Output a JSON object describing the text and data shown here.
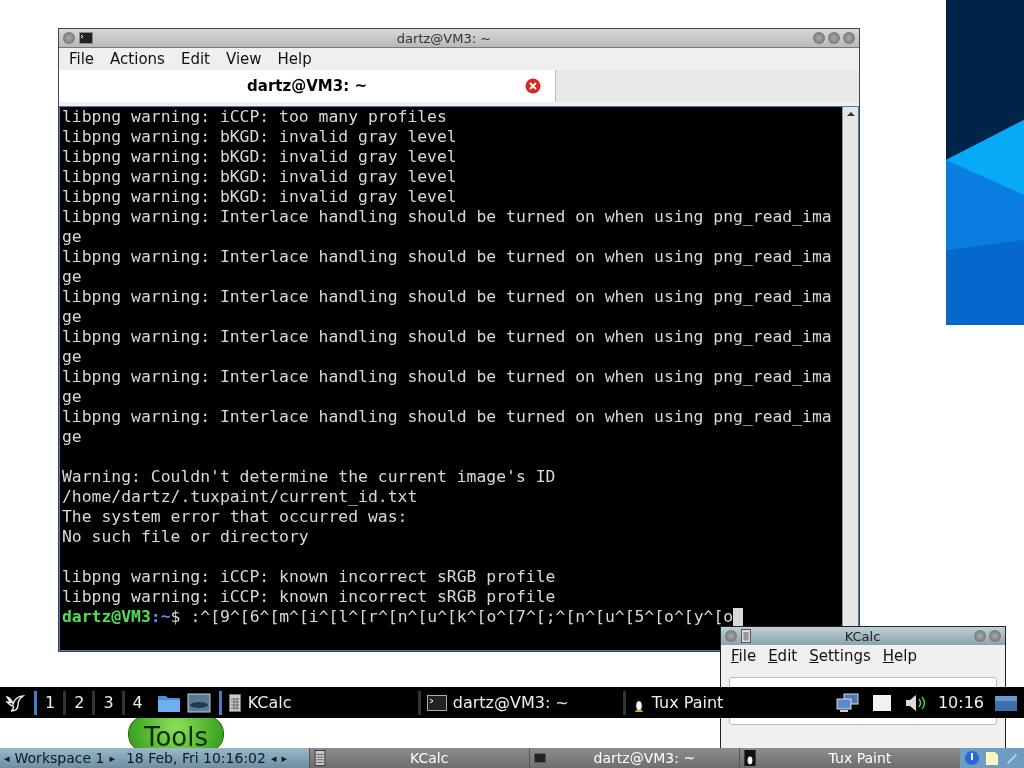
{
  "terminal": {
    "title": "dartz@VM3: ~",
    "menu": [
      "File",
      "Actions",
      "Edit",
      "View",
      "Help"
    ],
    "tab": {
      "label": "dartz@VM3: ~",
      "selected": true
    },
    "blocks": [
      [
        "libpng warning: iCCP: too many profiles",
        "libpng warning: bKGD: invalid gray level",
        "libpng warning: bKGD: invalid gray level",
        "libpng warning: bKGD: invalid gray level",
        "libpng warning: bKGD: invalid gray level",
        "libpng warning: Interlace handling should be turned on when using png_read_ima",
        "ge",
        "libpng warning: Interlace handling should be turned on when using png_read_ima",
        "ge",
        "libpng warning: Interlace handling should be turned on when using png_read_ima",
        "ge",
        "libpng warning: Interlace handling should be turned on when using png_read_ima",
        "ge",
        "libpng warning: Interlace handling should be turned on when using png_read_ima",
        "ge",
        "libpng warning: Interlace handling should be turned on when using png_read_ima",
        "ge"
      ],
      [
        "Warning: Couldn't determine the current image's ID",
        "/home/dartz/.tuxpaint/current_id.txt",
        "The system error that occurred was:",
        "No such file or directory"
      ],
      [
        "libpng warning: iCCP: known incorrect sRGB profile",
        "libpng warning: iCCP: known incorrect sRGB profile"
      ]
    ],
    "prompt": {
      "user": "dartz@VM3",
      "path": ":~",
      "symbol": "$",
      "command": ":^[9^[6^[m^[i^[l^[r^[n^[u^[k^[o^[7^[;^[n^[u^[5^[o^[y^[o"
    }
  },
  "kcalc": {
    "title": "KCalc",
    "menu": [
      "File",
      "Edit",
      "Settings",
      "Help"
    ]
  },
  "behind_button": "Tools",
  "taskbar": {
    "workspaces": [
      {
        "label": "1",
        "selected": true
      },
      {
        "label": "2",
        "selected": false
      },
      {
        "label": "3",
        "selected": false
      },
      {
        "label": "4",
        "selected": false
      }
    ],
    "tasks": [
      {
        "label": "KCalc",
        "kind": "calc"
      },
      {
        "label": "dartz@VM3: ~",
        "kind": "terminal"
      },
      {
        "label": "Tux Paint",
        "kind": "tux"
      }
    ],
    "clock": "10:16"
  },
  "bottom_panel": {
    "prev": "◂",
    "workspace": "Workspace 1",
    "next": "▸",
    "prev_day": "◂",
    "next_day": "▸",
    "datetime": "18 Feb, Fri 10:16:02",
    "tasks": [
      {
        "label": "KCalc",
        "kind": "calc"
      },
      {
        "label": "dartz@VM3: ~",
        "kind": "terminal"
      },
      {
        "label": "Tux Paint",
        "kind": "tux"
      }
    ]
  }
}
